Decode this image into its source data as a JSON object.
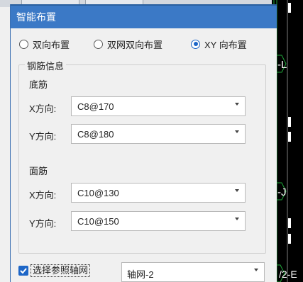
{
  "dialog": {
    "title": "智能布置",
    "layout_options": [
      {
        "label": "双向布置",
        "selected": false
      },
      {
        "label": "双网双向布置",
        "selected": false
      },
      {
        "label": "XY 向布置",
        "selected": true
      }
    ],
    "rebar_group": {
      "legend": "钢筋信息",
      "bottom": {
        "heading": "底筋",
        "x_label": "X方向:",
        "x_value": "C8@170",
        "y_label": "Y方向:",
        "y_value": "C8@180"
      },
      "top": {
        "heading": "面筋",
        "x_label": "X方向:",
        "x_value": "C10@130",
        "y_label": "Y方向:",
        "y_value": "C10@150"
      }
    },
    "ref_axis": {
      "checkbox_label": "选择参照轴网",
      "checked": true,
      "selected_grid": "轴网-2"
    }
  },
  "cad_labels": [
    "-L",
    "-J",
    "/2-E"
  ],
  "colors": {
    "titlebar": "#3b79c6",
    "accent": "#1d66c7",
    "cad_green": "#1fa83a"
  }
}
